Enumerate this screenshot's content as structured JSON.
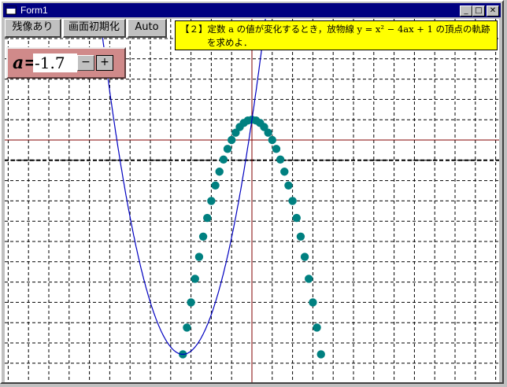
{
  "window": {
    "title": "Form1"
  },
  "titlebar_buttons": {
    "minimize": "_",
    "maximize": "□",
    "close": "✕"
  },
  "toolbar": {
    "afterimage_label": "残像あり",
    "reset_label": "画面初期化",
    "auto_label": "Auto"
  },
  "problem": {
    "line1": "【２】定数 a の値が変化するとき，放物線 y = x² − 4ax + 1 の頂点の軌跡",
    "line2": "を求めよ．"
  },
  "parameter": {
    "label": "a=",
    "value": "-1.7",
    "minus_label": "−",
    "plus_label": "+"
  },
  "icons": {
    "app": "form-icon",
    "minus": "minus-icon",
    "plus": "plus-icon"
  },
  "colors": {
    "parabola": "#0000c0",
    "locus": "#008080",
    "axes": "#800000",
    "grid": "#000000"
  },
  "plot": {
    "a_value": -1.7,
    "locus_a_values": [
      -1.7,
      -1.6,
      -1.5,
      -1.4,
      -1.3,
      -1.2,
      -1.1,
      -1.0,
      -0.9,
      -0.8,
      -0.7,
      -0.6,
      -0.5,
      -0.4,
      -0.3,
      -0.2,
      -0.1,
      0.0,
      0.1,
      0.2,
      0.3,
      0.4,
      0.5,
      0.6,
      0.7,
      0.8,
      0.9,
      1.0,
      1.1,
      1.2,
      1.3,
      1.4,
      1.5,
      1.6,
      1.7
    ]
  }
}
